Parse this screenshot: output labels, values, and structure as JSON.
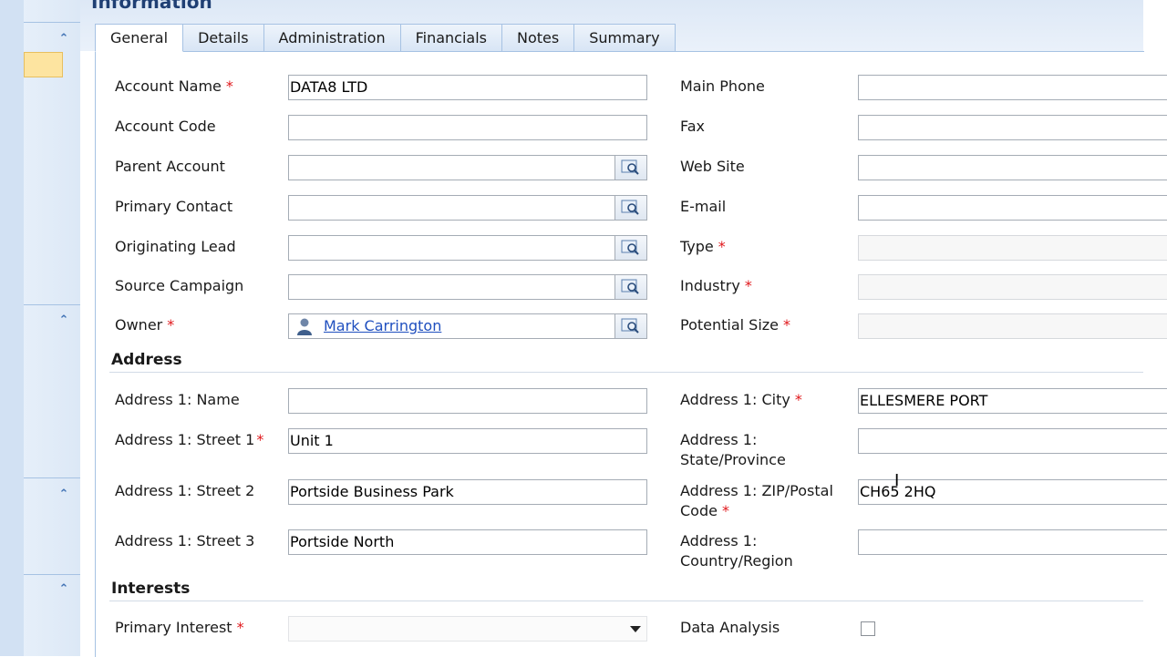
{
  "page_title": "Information",
  "tabs": [
    "General",
    "Details",
    "Administration",
    "Financials",
    "Notes",
    "Summary"
  ],
  "left": [
    {
      "label": "Account Name",
      "required": true,
      "value": "DATA8 LTD",
      "type": "text"
    },
    {
      "label": "Account Code",
      "required": false,
      "value": "",
      "type": "text"
    },
    {
      "label": "Parent Account",
      "required": false,
      "value": "",
      "type": "lookup"
    },
    {
      "label": "Primary Contact",
      "required": false,
      "value": "",
      "type": "lookup"
    },
    {
      "label": "Originating Lead",
      "required": false,
      "value": "",
      "type": "lookup"
    },
    {
      "label": "Source Campaign",
      "required": false,
      "value": "",
      "type": "lookup"
    },
    {
      "label": "Owner",
      "required": true,
      "value": "Mark Carrington",
      "type": "owner"
    }
  ],
  "right": [
    {
      "label": "Main Phone",
      "required": false,
      "value": ""
    },
    {
      "label": "Fax",
      "required": false,
      "value": ""
    },
    {
      "label": "Web Site",
      "required": false,
      "value": ""
    },
    {
      "label": "E-mail",
      "required": false,
      "value": ""
    },
    {
      "label": "Type",
      "required": true,
      "value": ""
    },
    {
      "label": "Industry",
      "required": true,
      "value": ""
    },
    {
      "label": "Potential Size",
      "required": true,
      "value": ""
    }
  ],
  "address": {
    "heading": "Address",
    "left": [
      {
        "label": "Address 1: Name",
        "required": false,
        "value": ""
      },
      {
        "label": "Address 1: Street 1",
        "required": true,
        "value": "Unit 1"
      },
      {
        "label": "Address 1: Street 2",
        "required": false,
        "value": "Portside Business Park"
      },
      {
        "label": "Address 1: Street 3",
        "required": false,
        "value": "Portside North"
      }
    ],
    "right": [
      {
        "label": "Address 1: City",
        "label2": "",
        "required": true,
        "value": "ELLESMERE PORT"
      },
      {
        "label": "Address 1:",
        "label2": "State/Province",
        "required": false,
        "value": ""
      },
      {
        "label": "Address 1: ZIP/Postal",
        "label2": "Code",
        "required": true,
        "value": "CH65 2HQ"
      },
      {
        "label": "Address 1:",
        "label2": "Country/Region",
        "required": false,
        "value": ""
      }
    ]
  },
  "interests": {
    "heading": "Interests",
    "primary_interest_label": "Primary Interest",
    "primary_interest_value": "",
    "data_analysis_label": "Data Analysis",
    "data_analysis_checked": false
  },
  "required_marker": "*"
}
